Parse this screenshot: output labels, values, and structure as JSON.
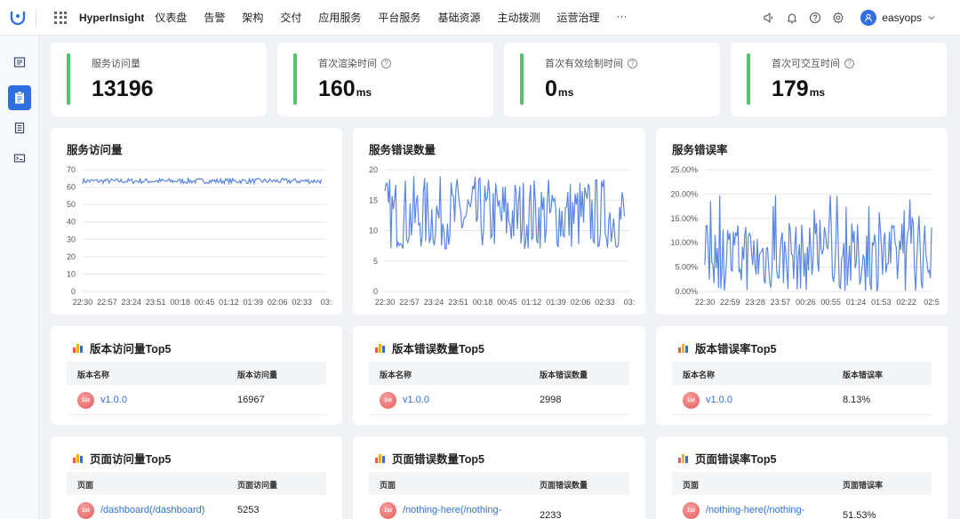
{
  "app": {
    "brand": "HyperInsight",
    "user": "easyops",
    "colors": {
      "accent": "#2f6fe0",
      "metric_bar": "#55c36b",
      "line": "#5b86e5"
    }
  },
  "nav": {
    "items": [
      "仪表盘",
      "告警",
      "架构",
      "交付",
      "应用服务",
      "平台服务",
      "基础资源",
      "主动拨测",
      "运营治理",
      "···"
    ]
  },
  "icons": [
    "app-logo-icon",
    "apps-grid-icon",
    "speaker-icon",
    "bell-icon",
    "help-icon",
    "settings-icon",
    "user-icon",
    "sidebar-list-icon",
    "sidebar-clipboard-icon",
    "sidebar-document-icon",
    "sidebar-terminal-icon",
    "chart-bar-icon",
    "rank-badge-icon"
  ],
  "metrics": [
    {
      "label": "服务访问量",
      "value": "13196",
      "unit": "",
      "help": false
    },
    {
      "label": "首次渲染时间",
      "value": "160",
      "unit": "ms",
      "help": true
    },
    {
      "label": "首次有效绘制时间",
      "value": "0",
      "unit": "ms",
      "help": true
    },
    {
      "label": "首次可交互时间",
      "value": "179",
      "unit": "ms",
      "help": true
    }
  ],
  "chart_titles": [
    "服务访问量",
    "服务错误数量",
    "服务错误率"
  ],
  "chart_data": [
    {
      "type": "line",
      "title": "服务访问量",
      "ylim": [
        0,
        70
      ],
      "yticks": [
        "70",
        "60",
        "50",
        "40",
        "30",
        "20",
        "10",
        "0"
      ],
      "xticks": [
        "22:30",
        "22:57",
        "23:24",
        "23:51",
        "00:18",
        "00:45",
        "01:12",
        "01:39",
        "02:06",
        "02:33",
        "03:"
      ],
      "series": [
        {
          "min": 62,
          "max": 65
        }
      ]
    },
    {
      "type": "line",
      "title": "服务错误数量",
      "ylim": [
        0,
        20
      ],
      "yticks": [
        "20",
        "15",
        "10",
        "5",
        "0"
      ],
      "xticks": [
        "22:30",
        "22:57",
        "23:24",
        "23:51",
        "00:18",
        "00:45",
        "01:12",
        "01:39",
        "02:06",
        "02:33",
        "03:"
      ],
      "series": [
        {
          "min": 7,
          "max": 19
        }
      ]
    },
    {
      "type": "line",
      "title": "服务错误率",
      "ylim": [
        0,
        25
      ],
      "yticks": [
        "25.00%",
        "20.00%",
        "15.00%",
        "10.00%",
        "5.00%",
        "0.00%"
      ],
      "xticks": [
        "22:30",
        "22:59",
        "23:28",
        "23:57",
        "00:26",
        "00:55",
        "01:24",
        "01:53",
        "02:22",
        "02:5"
      ],
      "series": [
        {
          "min": 0,
          "max": 21.5
        }
      ]
    }
  ],
  "tables": [
    {
      "title": "版本访问量Top5",
      "col1": "版本名称",
      "col2": "版本访问量",
      "rank": "1st",
      "link": "v1.0.0",
      "value": "16967"
    },
    {
      "title": "版本错误数量Top5",
      "col1": "版本名称",
      "col2": "版本错误数量",
      "rank": "1st",
      "link": "v1.0.0",
      "value": "2998"
    },
    {
      "title": "版本错误率Top5",
      "col1": "版本名称",
      "col2": "版本错误率",
      "rank": "1st",
      "link": "v1.0.0",
      "value": "8.13%"
    },
    {
      "title": "页面访问量Top5",
      "col1": "页面",
      "col2": "页面访问量",
      "rank": "1st",
      "link": "/dashboard(/dashboard)",
      "value": "5253"
    },
    {
      "title": "页面错误数量Top5",
      "col1": "页面",
      "col2": "页面错误数量",
      "rank": "1st",
      "link": "/nothing-here(/nothing-",
      "value": "2233"
    },
    {
      "title": "页面错误率Top5",
      "col1": "页面",
      "col2": "页面错误率",
      "rank": "1st",
      "link": "/nothing-here(/nothing-",
      "value": "51.53%"
    }
  ]
}
